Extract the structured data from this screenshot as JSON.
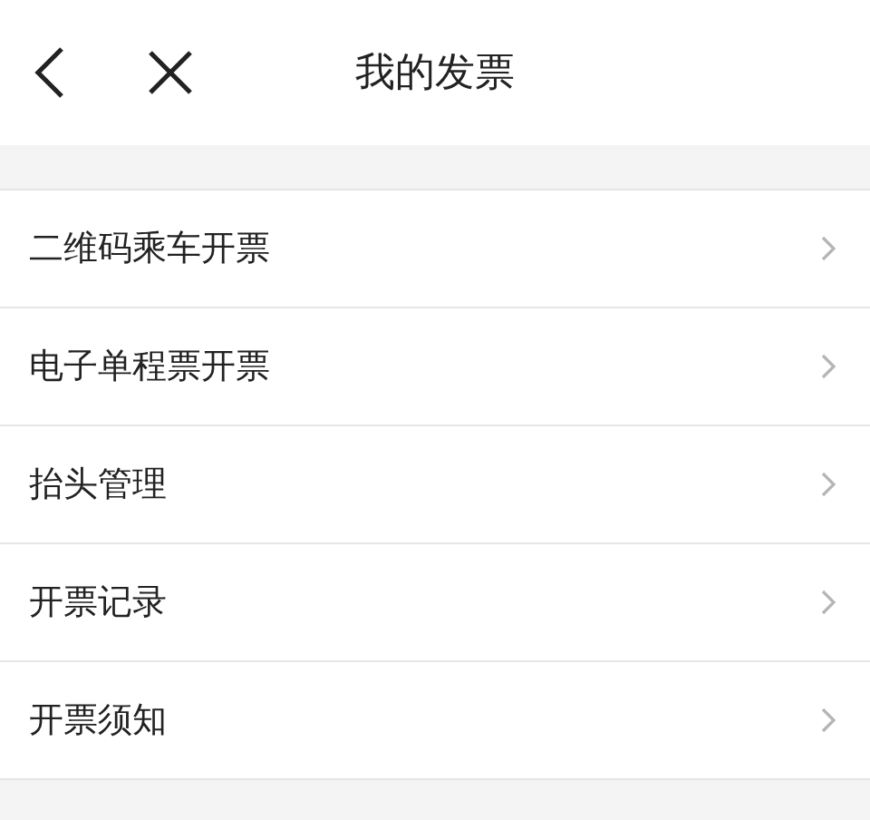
{
  "header": {
    "title": "我的发票"
  },
  "menu": [
    {
      "label": "二维码乘车开票"
    },
    {
      "label": "电子单程票开票"
    },
    {
      "label": "抬头管理"
    },
    {
      "label": "开票记录"
    },
    {
      "label": "开票须知"
    }
  ]
}
